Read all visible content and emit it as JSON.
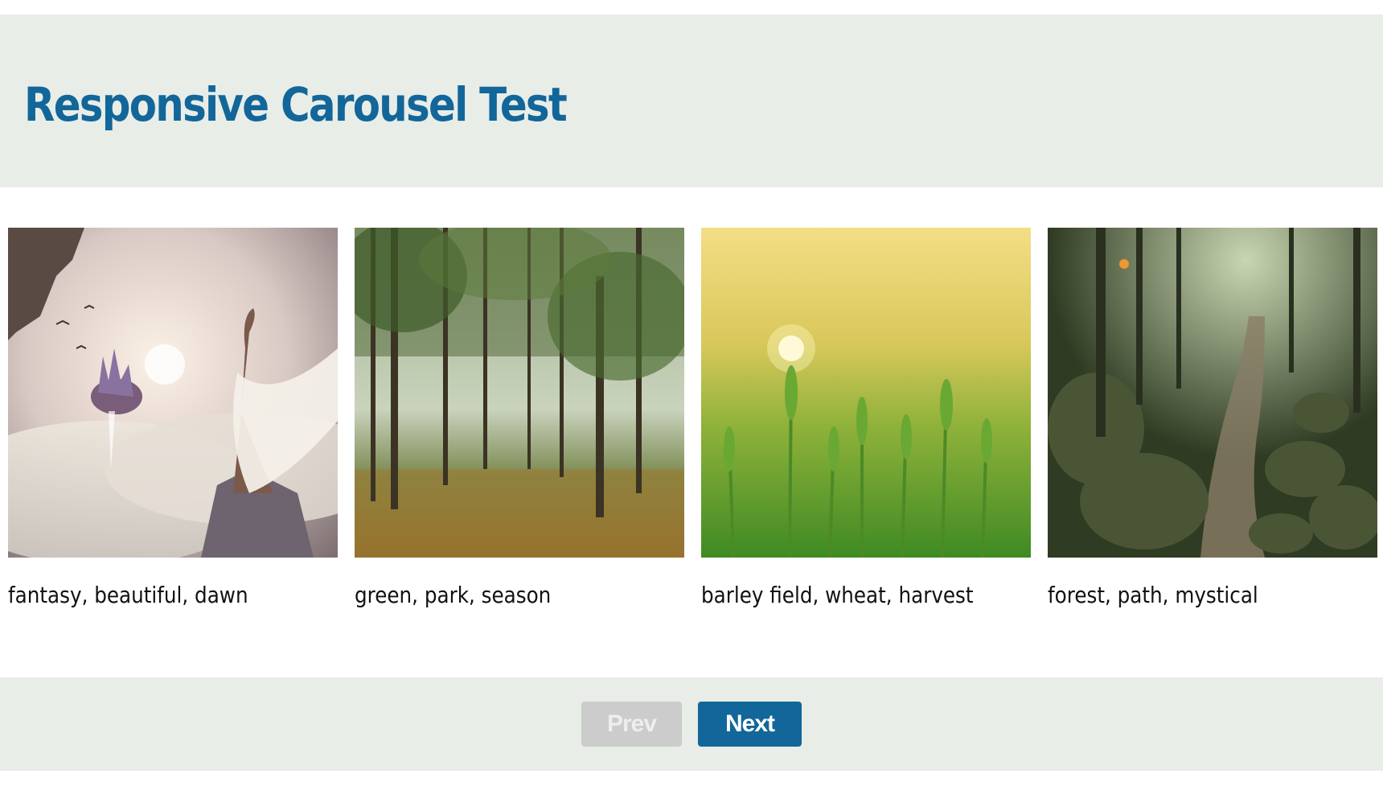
{
  "header": {
    "title": "Responsive Carousel Test"
  },
  "carousel": {
    "items": [
      {
        "caption": "fantasy, beautiful, dawn",
        "image": "woman-on-cliff-floating-castle-clouds"
      },
      {
        "caption": "green, park, season",
        "image": "sunlit-tree-forest"
      },
      {
        "caption": "barley field, wheat, harvest",
        "image": "barley-field-at-sunrise"
      },
      {
        "caption": "forest, path, mystical",
        "image": "rocky-forest-path"
      }
    ]
  },
  "pagination": {
    "prev_label": "Prev",
    "next_label": "Next",
    "prev_disabled": true
  },
  "colors": {
    "accent": "#126699",
    "band_background": "#e8ede7",
    "disabled_button": "#cccccc"
  }
}
